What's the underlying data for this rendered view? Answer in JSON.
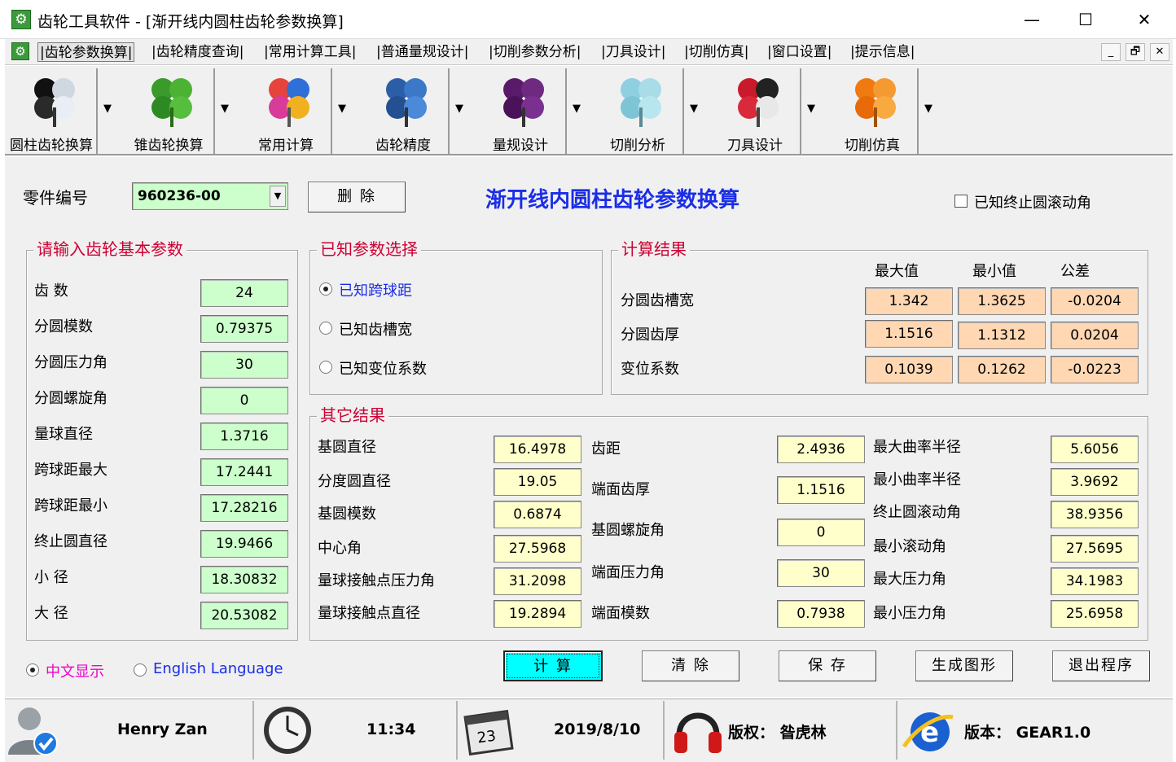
{
  "window": {
    "title": "齿轮工具软件 - [渐开线内圆柱齿轮参数换算]",
    "minimize": "—",
    "maximize": "☐",
    "close": "✕"
  },
  "menu": {
    "items": [
      "|齿轮参数换算|",
      "|齿轮精度查询|",
      "|常用计算工具|",
      "|普通量规设计|",
      "|切削参数分析|",
      "|刀具设计|",
      "|切削仿真|",
      "|窗口设置|",
      "|提示信息|"
    ],
    "mdi_min": "_",
    "mdi_restore": "🗗",
    "mdi_close": "✕"
  },
  "toolbar": {
    "items": [
      "圆柱齿轮换算",
      "锥齿轮换算",
      "常用计算",
      "齿轮精度",
      "量规设计",
      "切削分析",
      "刀具设计",
      "切削仿真"
    ],
    "dropdown_glyph": "▼"
  },
  "header": {
    "part_no_label": "零件编号",
    "part_no_value": "960236-00",
    "delete_button": "删 除",
    "page_title": "渐开线内圆柱齿轮参数换算",
    "known_end_roll_label": "已知终止圆滚动角"
  },
  "inputs": {
    "title": "请输入齿轮基本参数",
    "rows": [
      {
        "label": "齿 数",
        "value": "24"
      },
      {
        "label": "分圆模数",
        "value": "0.79375"
      },
      {
        "label": "分圆压力角",
        "value": "30"
      },
      {
        "label": "分圆螺旋角",
        "value": "0"
      },
      {
        "label": "量球直径",
        "value": "1.3716"
      },
      {
        "label": "跨球距最大",
        "value": "17.2441"
      },
      {
        "label": "跨球距最小",
        "value": "17.28216"
      },
      {
        "label": "终止圆直径",
        "value": "19.9466"
      },
      {
        "label": "小 径",
        "value": "18.30832"
      },
      {
        "label": "大 径",
        "value": "20.53082"
      }
    ]
  },
  "known": {
    "title": "已知参数选择",
    "options": [
      "已知跨球距",
      "已知齿槽宽",
      "已知变位系数"
    ],
    "selected_index": 0
  },
  "results": {
    "title": "计算结果",
    "col_headers": [
      "最大值",
      "最小值",
      "公差"
    ],
    "rows": [
      {
        "label": "分圆齿槽宽",
        "max": "1.342",
        "min": "1.3625",
        "tol": "-0.0204"
      },
      {
        "label": "分圆齿厚",
        "max": "1.1516",
        "min": "1.1312",
        "tol": "0.0204"
      },
      {
        "label": "变位系数",
        "max": "0.1039",
        "min": "0.1262",
        "tol": "-0.0223"
      }
    ]
  },
  "other": {
    "title": "其它结果",
    "col1": [
      {
        "label": "基圆直径",
        "value": "16.4978"
      },
      {
        "label": "分度圆直径",
        "value": "19.05"
      },
      {
        "label": "基圆模数",
        "value": "0.6874"
      },
      {
        "label": "中心角",
        "value": "27.5968"
      },
      {
        "label": "量球接触点压力角",
        "value": "31.2098"
      },
      {
        "label": "量球接触点直径",
        "value": "19.2894"
      }
    ],
    "col2_labels": [
      "齿距",
      "端面齿厚",
      "基圆螺旋角",
      "端面压力角",
      "端面模数"
    ],
    "col2_values": [
      "2.4936",
      "1.1516",
      "0",
      "30",
      "0.7938"
    ],
    "col3": [
      {
        "label": "最大曲率半径",
        "value": "5.6056"
      },
      {
        "label": "最小曲率半径",
        "value": "3.9692"
      },
      {
        "label": "终止圆滚动角",
        "value": "38.9356"
      },
      {
        "label": "最小滚动角",
        "value": "27.5695"
      },
      {
        "label": "最大压力角",
        "value": "34.1983"
      },
      {
        "label": "最小压力角",
        "value": "25.6958"
      }
    ]
  },
  "language": {
    "chinese": "中文显示",
    "english": "English Language",
    "selected": "chinese"
  },
  "actions": {
    "calculate": "计 算",
    "clear": "清 除",
    "save": "保 存",
    "graph": "生成图形",
    "exit": "退出程序"
  },
  "status": {
    "user": "Henry Zan",
    "time": "11:34",
    "date": "2019/8/10",
    "calendar_day": "23",
    "copyright": "版权： 昝虎林",
    "version": "版本： GEAR1.0"
  },
  "colors": {
    "input_field": "#ccffcc",
    "result_field": "#ffd7b3",
    "other_field": "#ffffcc",
    "group_title": "#cc0033",
    "page_title": "#1a2ee6",
    "calc_button": "#00ffff"
  }
}
